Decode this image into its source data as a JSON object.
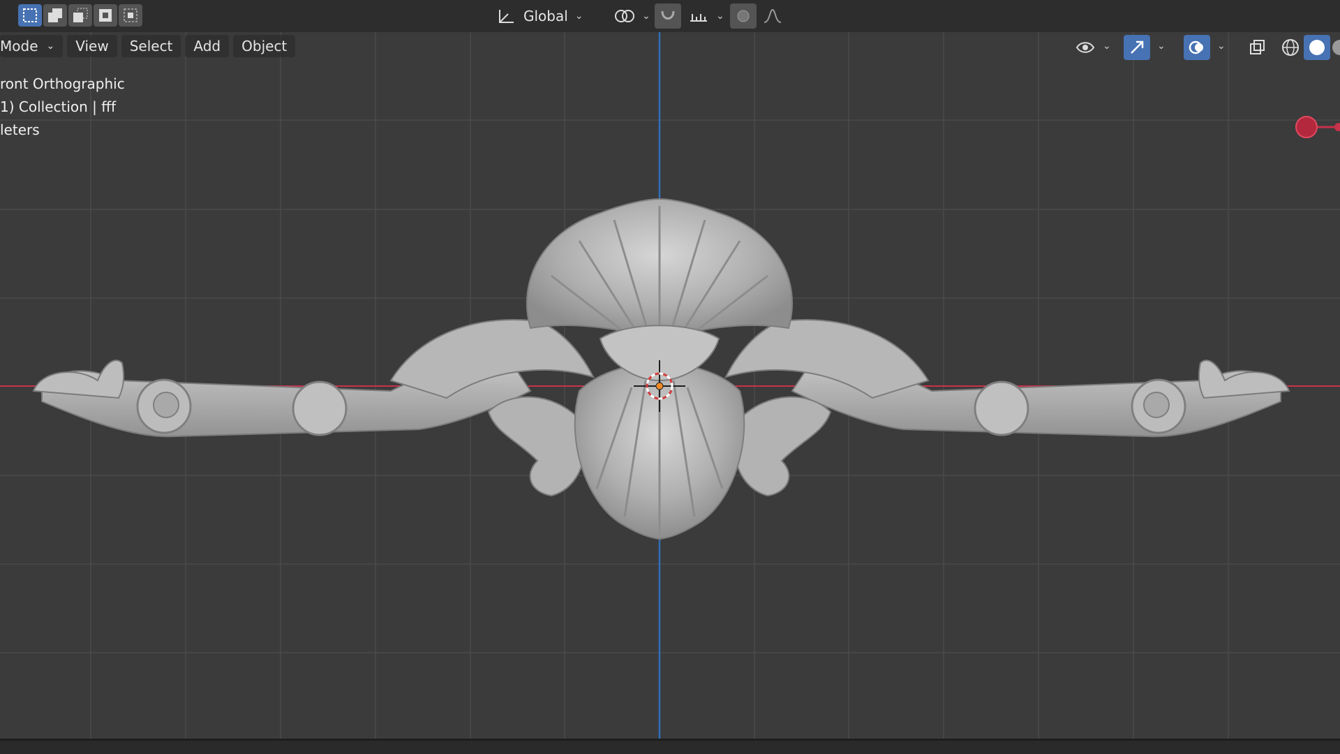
{
  "header": {
    "orientation": {
      "label": "Global"
    }
  },
  "menu": {
    "mode_label": "Mode",
    "items": [
      "View",
      "Select",
      "Add",
      "Object"
    ]
  },
  "viewport_info": {
    "view_name": "ront Orthographic",
    "collection": "1) Collection | fff",
    "units": "leters"
  },
  "icons": {
    "select_box": "select-box-icon",
    "transform_orientation": "orientation-axes-icon",
    "pivot": "pivot-point-icon",
    "snap": "snap-magnet-icon",
    "proportional": "proportional-editing-icon",
    "visibility": "visibility-eye-icon",
    "gizmo": "gizmo-icon",
    "overlays": "overlays-icon",
    "xray": "xray-icon",
    "shading": "shading-modes-icon"
  },
  "colors": {
    "background": "#3b3b3b",
    "grid": "#4a4a4a",
    "x_axis": "#c8324a",
    "z_axis": "#2f6fb7",
    "accent": "#4772b3",
    "object": "#a9a9a9"
  }
}
